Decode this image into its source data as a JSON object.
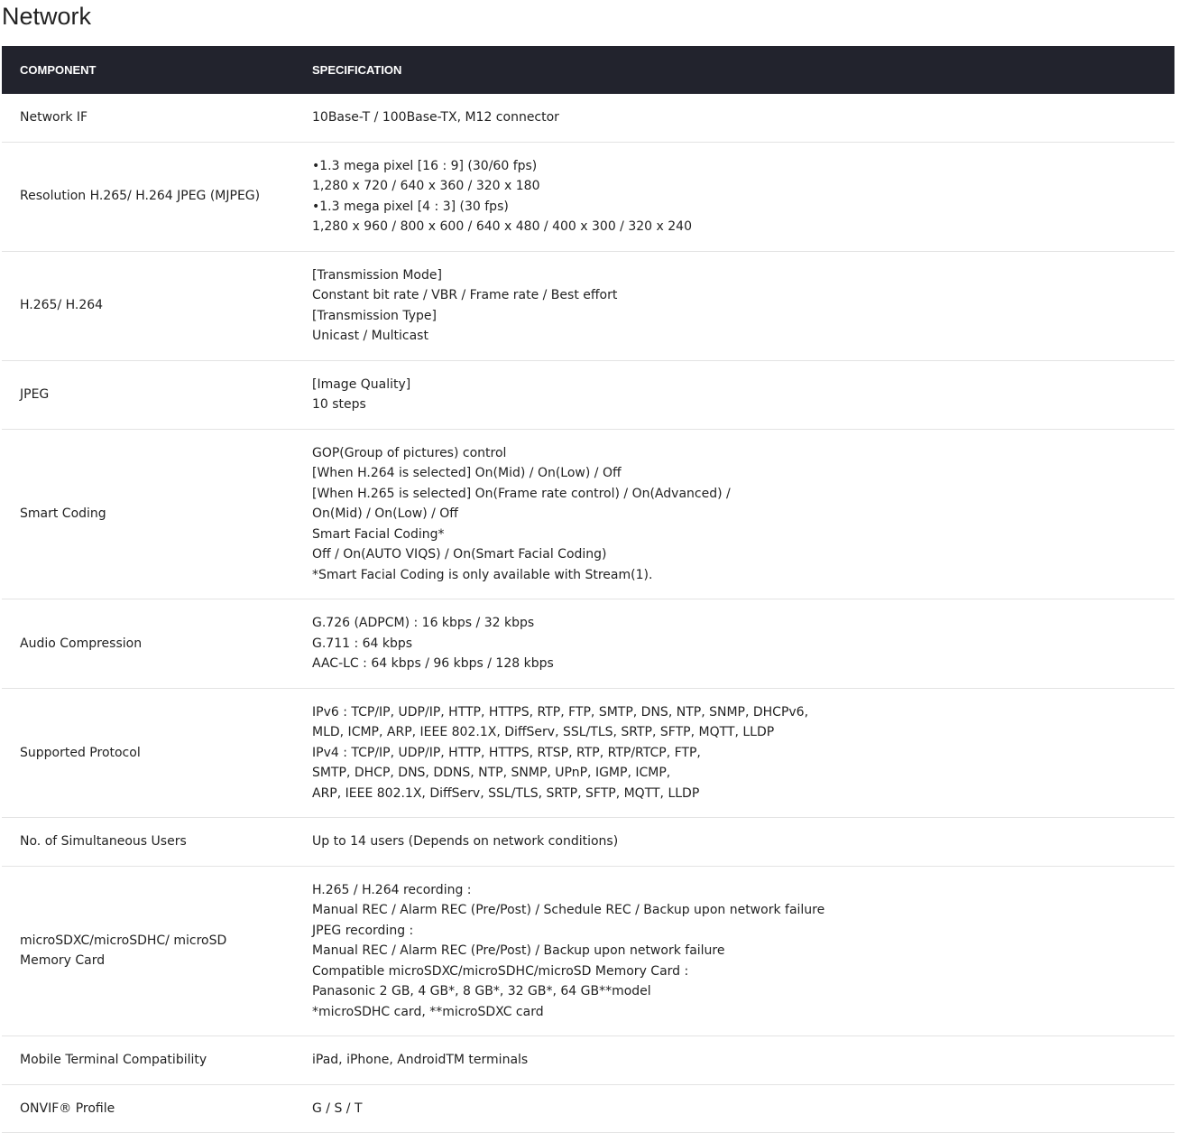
{
  "page": {
    "title": "Network"
  },
  "table": {
    "headers": [
      "COMPONENT",
      "SPECIFICATION"
    ],
    "rows": [
      {
        "component": "Network IF",
        "spec": [
          "10Base-T / 100Base-TX, M12 connector"
        ]
      },
      {
        "component": "Resolution H.265/ H.264 JPEG (MJPEG)",
        "spec": [
          "•1.3 mega pixel [16 : 9] (30/60 fps)",
          "1,280 x 720 / 640 x 360 / 320 x 180",
          "•1.3 mega pixel [4 : 3] (30 fps)",
          "1,280 x 960 / 800 x 600 / 640 x 480 / 400 x 300 / 320 x 240"
        ]
      },
      {
        "component": "H.265/ H.264",
        "spec": [
          "[Transmission Mode]",
          "Constant bit rate / VBR / Frame rate / Best effort",
          "[Transmission Type]",
          "Unicast / Multicast"
        ]
      },
      {
        "component": "JPEG",
        "spec": [
          "[Image Quality]",
          "10 steps"
        ]
      },
      {
        "component": "Smart Coding",
        "spec": [
          "GOP(Group of pictures) control",
          "[When H.264 is selected] On(Mid) / On(Low) / Off",
          "[When H.265 is selected] On(Frame rate control) / On(Advanced) /",
          "On(Mid) / On(Low) / Off",
          "Smart Facial Coding*",
          "Off / On(AUTO VIQS) / On(Smart Facial Coding)",
          "*Smart Facial Coding is only available with Stream(1)."
        ]
      },
      {
        "component": "Audio Compression",
        "spec": [
          "G.726 (ADPCM) : 16 kbps / 32 kbps",
          "G.711 : 64 kbps",
          "AAC-LC : 64 kbps / 96 kbps / 128 kbps"
        ]
      },
      {
        "component": "Supported Protocol",
        "spec": [
          "IPv6 : TCP/IP, UDP/IP, HTTP, HTTPS, RTP, FTP, SMTP, DNS, NTP, SNMP, DHCPv6,",
          "MLD, ICMP, ARP, IEEE 802.1X, DiffServ, SSL/TLS, SRTP, SFTP, MQTT, LLDP",
          "IPv4 : TCP/IP, UDP/IP, HTTP, HTTPS, RTSP, RTP, RTP/RTCP, FTP,",
          "SMTP, DHCP, DNS, DDNS, NTP, SNMP, UPnP, IGMP, ICMP,",
          "ARP, IEEE 802.1X, DiffServ, SSL/TLS, SRTP, SFTP, MQTT, LLDP"
        ]
      },
      {
        "component": "No. of Simultaneous Users",
        "spec": [
          "Up to 14 users (Depends on network conditions)"
        ]
      },
      {
        "component": "microSDXC/microSDHC/ microSD Memory Card",
        "spec": [
          "H.265 / H.264 recording :",
          "Manual REC / Alarm REC (Pre/Post) / Schedule REC / Backup upon network failure",
          "JPEG recording :",
          "Manual REC / Alarm REC (Pre/Post) / Backup upon network failure",
          "Compatible microSDXC/microSDHC/microSD Memory Card :",
          "Panasonic 2 GB, 4 GB*, 8 GB*, 32 GB*, 64 GB**model",
          "*microSDHC card, **microSDXC card"
        ]
      },
      {
        "component": "Mobile Terminal Compatibility",
        "spec": [
          "iPad, iPhone, AndroidTM terminals"
        ]
      },
      {
        "component": "ONVIF® Profile",
        "spec": [
          "G / S / T"
        ]
      }
    ]
  }
}
